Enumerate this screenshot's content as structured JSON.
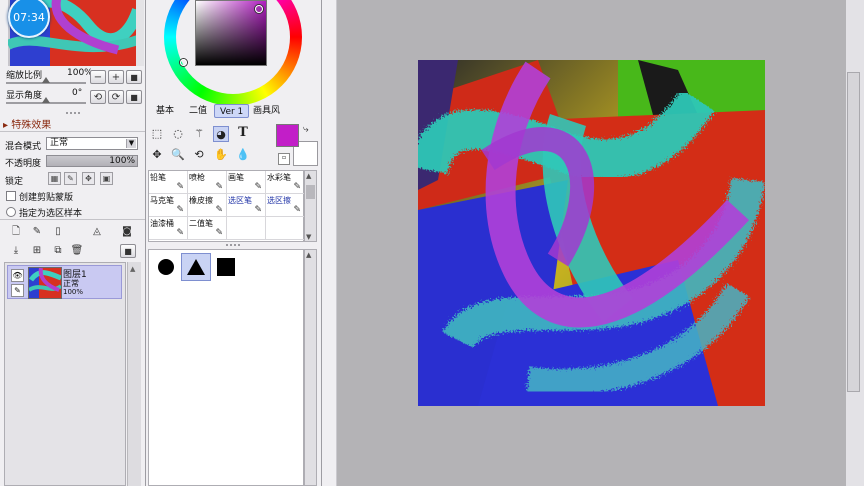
{
  "navigator": {
    "clock": "07:34"
  },
  "view": {
    "zoom_label": "缩放比例",
    "zoom_value": "100%",
    "angle_label": "显示角度",
    "angle_value": "0°",
    "zoom_out": "−",
    "zoom_in": "+",
    "zoom_reset": "■",
    "rotate_left": "⟲",
    "rotate_right": "⟳",
    "rotate_reset": "■"
  },
  "effects": {
    "header": "特殊效果"
  },
  "layer_props": {
    "blend_label": "混合模式",
    "blend_value": "正常",
    "opacity_label": "不透明度",
    "opacity_value": "100%",
    "opacity_fraction": 1.0,
    "lock_label": "锁定",
    "clip_label": "创建剪贴蒙版",
    "select_source_label": "指定为选区样本"
  },
  "layers": {
    "items": [
      {
        "name": "图层1",
        "mode": "正常",
        "opacity": "100%"
      }
    ]
  },
  "color": {
    "current": "#c21ec8",
    "background": "#ffffff",
    "tabs": [
      "基本",
      "二值",
      "Ver 1",
      "画具风"
    ],
    "active_tab": "Ver 1"
  },
  "brushes": {
    "rows": [
      [
        {
          "label": "铅笔",
          "icon": "pencil-icon"
        },
        {
          "label": "喷枪",
          "icon": "airbrush-icon"
        },
        {
          "label": "画笔",
          "icon": "brush-icon"
        },
        {
          "label": "水彩笔",
          "icon": "watercolor-icon"
        }
      ],
      [
        {
          "label": "马克笔",
          "icon": "marker-icon"
        },
        {
          "label": "橡皮擦",
          "icon": "eraser-icon"
        },
        {
          "label": "选区笔",
          "icon": "selpen-icon"
        },
        {
          "label": "选区擦",
          "icon": "selerase-icon"
        }
      ],
      [
        {
          "label": "油漆桶",
          "icon": "bucket-icon"
        },
        {
          "label": "二值笔",
          "icon": "binary-pen-icon"
        },
        {
          "label": "",
          "icon": ""
        },
        {
          "label": "",
          "icon": ""
        }
      ]
    ]
  },
  "brush_shapes": [
    "circle",
    "triangle",
    "square"
  ]
}
